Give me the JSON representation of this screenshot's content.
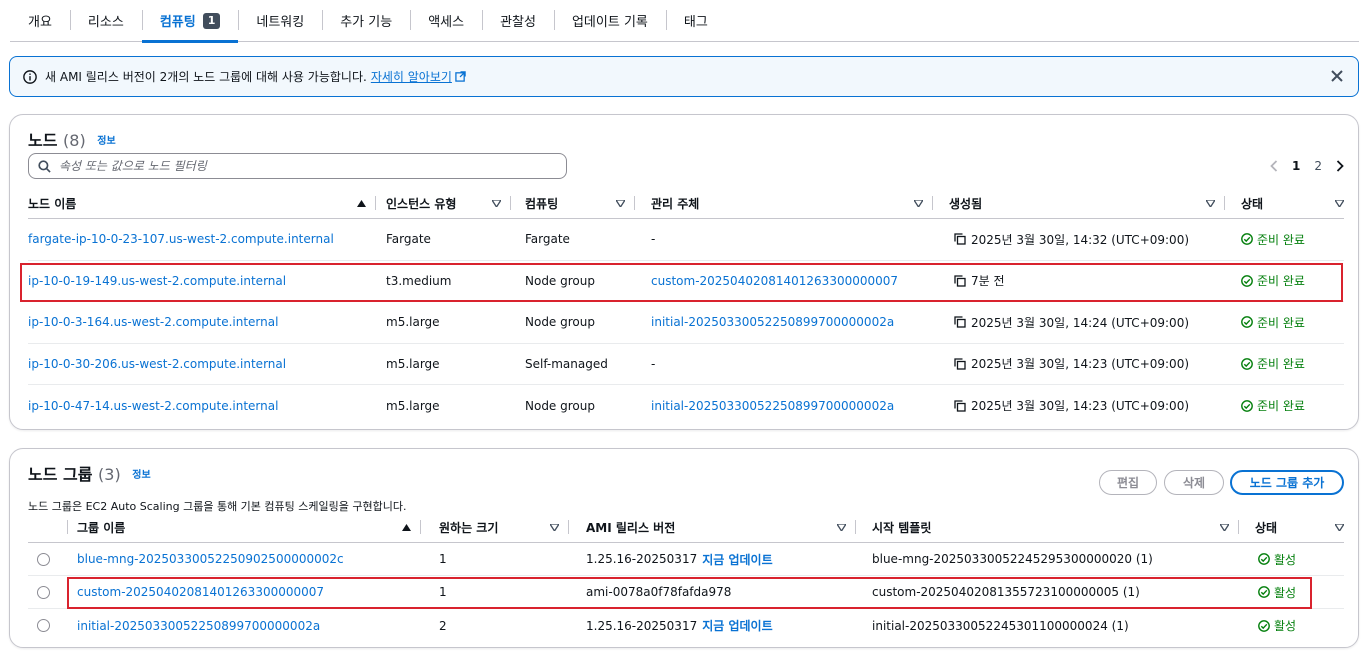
{
  "tabs": [
    {
      "label": "개요"
    },
    {
      "label": "리소스"
    },
    {
      "label": "컴퓨팅",
      "count": "1"
    },
    {
      "label": "네트워킹"
    },
    {
      "label": "추가 기능"
    },
    {
      "label": "액세스"
    },
    {
      "label": "관찰성"
    },
    {
      "label": "업데이트 기록"
    },
    {
      "label": "태그"
    }
  ],
  "flash": {
    "message": "새 AMI 릴리스 버전이 2개의 노드 그룹에 대해 사용 가능합니다.",
    "learn_more": "자세히 알아보기"
  },
  "nodes": {
    "title": "노드",
    "count": "(8)",
    "info": "정보",
    "search_placeholder": "속성 또는 값으로 노드 필터링",
    "pages": [
      "1",
      "2"
    ],
    "columns": [
      "노드 이름",
      "인스턴스 유형",
      "컴퓨팅",
      "관리 주체",
      "생성됨",
      "상태"
    ],
    "rows": [
      {
        "name": "fargate-ip-10-0-23-107.us-west-2.compute.internal",
        "type": "Fargate",
        "compute": "Fargate",
        "managed": "-",
        "created": "2025년 3월 30일, 14:32 (UTC+09:00)",
        "status": "준비 완료"
      },
      {
        "name": "ip-10-0-19-149.us-west-2.compute.internal",
        "type": "t3.medium",
        "compute": "Node group",
        "managed": "custom-20250402081401263300000007",
        "created": "7분 전",
        "status": "준비 완료"
      },
      {
        "name": "ip-10-0-3-164.us-west-2.compute.internal",
        "type": "m5.large",
        "compute": "Node group",
        "managed": "initial-20250330052250899700000002a",
        "created": "2025년 3월 30일, 14:24 (UTC+09:00)",
        "status": "준비 완료"
      },
      {
        "name": "ip-10-0-30-206.us-west-2.compute.internal",
        "type": "m5.large",
        "compute": "Self-managed",
        "managed": "-",
        "created": "2025년 3월 30일, 14:23 (UTC+09:00)",
        "status": "준비 완료"
      },
      {
        "name": "ip-10-0-47-14.us-west-2.compute.internal",
        "type": "m5.large",
        "compute": "Node group",
        "managed": "initial-20250330052250899700000002a",
        "created": "2025년 3월 30일, 14:23 (UTC+09:00)",
        "status": "준비 완료"
      }
    ]
  },
  "nodegroups": {
    "title": "노드 그룹",
    "count": "(3)",
    "info": "정보",
    "description": "노드 그룹은 EC2 Auto Scaling 그룹을 통해 기본 컴퓨팅 스케일링을 구현합니다.",
    "buttons": {
      "edit": "편집",
      "delete": "삭제",
      "add": "노드 그룹 추가"
    },
    "columns": [
      "그룹 이름",
      "원하는 크기",
      "AMI 릴리스 버전",
      "시작 템플릿",
      "상태"
    ],
    "rows": [
      {
        "name": "blue-mng-20250330052250902500000002c",
        "size": "1",
        "ami": "1.25.16-20250317",
        "update": "지금 업데이트",
        "template": "blue-mng-20250330052245295300000020 (1)",
        "status": "활성"
      },
      {
        "name": "custom-20250402081401263300000007",
        "size": "1",
        "ami": "ami-0078a0f78fafda978",
        "update": "",
        "template": "custom-20250402081355723100000005 (1)",
        "status": "활성"
      },
      {
        "name": "initial-20250330052250899700000002a",
        "size": "2",
        "ami": "1.25.16-20250317",
        "update": "지금 업데이트",
        "template": "initial-20250330052245301100000024 (1)",
        "status": "활성"
      }
    ]
  },
  "colors": {
    "link": "#0972d3",
    "success": "#037f0c",
    "highlight": "#d9232e"
  }
}
